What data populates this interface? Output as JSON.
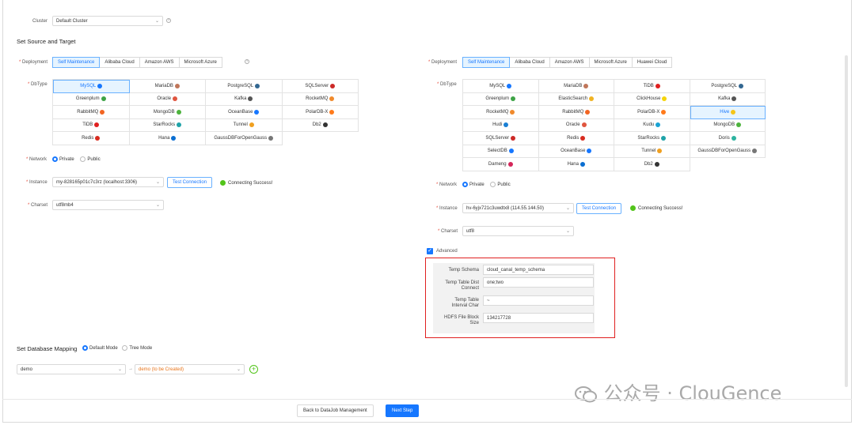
{
  "cluster": {
    "label": "Cluster",
    "value": "Default Cluster"
  },
  "sections": {
    "source_target": "Set Source and Target",
    "db_mapping": "Set Database Mapping"
  },
  "source": {
    "deployment_label": "Deployment",
    "deployment_tabs": [
      "Self Maintenance",
      "Alibaba Cloud",
      "Amazon AWS",
      "Microsoft Azure"
    ],
    "dbtype_label": "DbType",
    "dbtypes": [
      {
        "name": "MySQL",
        "color": "#1677ff"
      },
      {
        "name": "MariaDB",
        "color": "#c0765a"
      },
      {
        "name": "PostgreSQL",
        "color": "#336791"
      },
      {
        "name": "SQLServer",
        "color": "#cc2927"
      },
      {
        "name": "Greenplum",
        "color": "#3ea346"
      },
      {
        "name": "Oracle",
        "color": "#e0553f"
      },
      {
        "name": "Kafka",
        "color": "#555555"
      },
      {
        "name": "RocketMQ",
        "color": "#f08a2c"
      },
      {
        "name": "RabbitMQ",
        "color": "#f26522"
      },
      {
        "name": "MongoDB",
        "color": "#4db33d"
      },
      {
        "name": "OceanBase",
        "color": "#1677ff"
      },
      {
        "name": "PolarDB-X",
        "color": "#ff7a1a"
      },
      {
        "name": "TiDB",
        "color": "#e02020"
      },
      {
        "name": "StarRocks",
        "color": "#1fa3a8"
      },
      {
        "name": "Tunnel",
        "color": "#f0a020"
      },
      {
        "name": "Db2",
        "color": "#333333"
      },
      {
        "name": "Redis",
        "color": "#d82c20"
      },
      {
        "name": "Hana",
        "color": "#0a6ed1"
      },
      {
        "name": "GaussDBForOpenGauss",
        "color": "#777777"
      }
    ],
    "network_label": "Network",
    "network_options": [
      "Private",
      "Public"
    ],
    "instance_label": "Instance",
    "instance_value": "my-828165p01c7c3rz (localhost:3306)",
    "test_button": "Test Connection",
    "status": "Connecting Success!",
    "charset_label": "Charset",
    "charset_value": "utf8mb4"
  },
  "target": {
    "deployment_label": "Deployment",
    "deployment_tabs": [
      "Self Maintenance",
      "Alibaba Cloud",
      "Amazon AWS",
      "Microsoft Azure",
      "Huawei Cloud"
    ],
    "dbtype_label": "DbType",
    "dbtypes": [
      {
        "name": "MySQL",
        "color": "#1677ff"
      },
      {
        "name": "MariaDB",
        "color": "#c0765a"
      },
      {
        "name": "TiDB",
        "color": "#e02020"
      },
      {
        "name": "PostgreSQL",
        "color": "#336791"
      },
      {
        "name": "Greenplum",
        "color": "#3ea346"
      },
      {
        "name": "ElasticSearch",
        "color": "#f0b323"
      },
      {
        "name": "ClickHouse",
        "color": "#f5d40a"
      },
      {
        "name": "Kafka",
        "color": "#555555"
      },
      {
        "name": "RocketMQ",
        "color": "#f08a2c"
      },
      {
        "name": "RabbitMQ",
        "color": "#f26522"
      },
      {
        "name": "PolarDB-X",
        "color": "#ff7a1a"
      },
      {
        "name": "Hive",
        "color": "#f5c518"
      },
      {
        "name": "Hudi",
        "color": "#1a7fd4"
      },
      {
        "name": "Oracle",
        "color": "#e0553f"
      },
      {
        "name": "Kudu",
        "color": "#1aa3d4"
      },
      {
        "name": "MongoDB",
        "color": "#4db33d"
      },
      {
        "name": "SQLServer",
        "color": "#cc2927"
      },
      {
        "name": "Redis",
        "color": "#d82c20"
      },
      {
        "name": "StarRocks",
        "color": "#1fa3a8"
      },
      {
        "name": "Doris",
        "color": "#2db3a0"
      },
      {
        "name": "SelectDB",
        "color": "#1677ff"
      },
      {
        "name": "OceanBase",
        "color": "#1677ff"
      },
      {
        "name": "Tunnel",
        "color": "#f0a020"
      },
      {
        "name": "GaussDBForOpenGauss",
        "color": "#777777"
      },
      {
        "name": "Dameng",
        "color": "#d4265a"
      },
      {
        "name": "Hana",
        "color": "#0a6ed1"
      },
      {
        "name": "Db2",
        "color": "#333333"
      }
    ],
    "network_label": "Network",
    "network_options": [
      "Private",
      "Public"
    ],
    "instance_label": "Instance",
    "instance_value": "hv-6yjx721c3uwdtx8 (114.55.144.50)",
    "test_button": "Test Connection",
    "status": "Connecting Success!",
    "charset_label": "Charset",
    "charset_value": "utf8",
    "advanced_label": "Advanced",
    "advanced": {
      "temp_schema_label": "Temp Schema",
      "temp_schema_value": "cloud_canal_temp_schema",
      "dist_connect_label_1": "Temp Table Dist",
      "dist_connect_label_2": "Connect",
      "dist_connect_value": "one;two",
      "interval_label_1": "Temp Table",
      "interval_label_2": "Interval Char",
      "interval_value": "~",
      "block_size_label_1": "HDFS File Block",
      "block_size_label_2": "Size",
      "block_size_value": "134217728"
    }
  },
  "mapping": {
    "modes": [
      "Default Mode",
      "Tree Mode"
    ],
    "source_db": "demo",
    "target_db": "demo (to be Created)",
    "arrow": "→"
  },
  "footer": {
    "back_button": "Back to DataJob Management",
    "next_button": "Next Step"
  },
  "watermark": "公众号 · ClouGence",
  "colors": {
    "accent": "#1677ff",
    "success": "#52c41a",
    "highlight": "#e02020"
  }
}
